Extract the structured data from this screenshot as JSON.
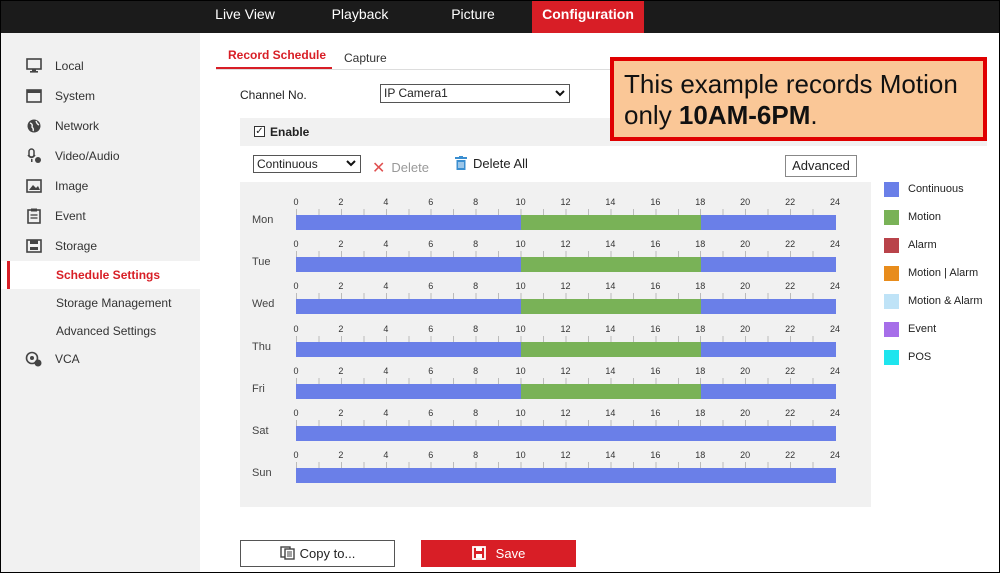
{
  "topnav": {
    "tabs": [
      {
        "label": "Live View"
      },
      {
        "label": "Playback"
      },
      {
        "label": "Picture"
      },
      {
        "label": "Configuration"
      }
    ]
  },
  "sidebar": {
    "items": [
      {
        "label": "Local",
        "icon": "monitor-icon"
      },
      {
        "label": "System",
        "icon": "window-icon"
      },
      {
        "label": "Network",
        "icon": "globe-icon"
      },
      {
        "label": "Video/Audio",
        "icon": "mic-icon"
      },
      {
        "label": "Image",
        "icon": "image-icon"
      },
      {
        "label": "Event",
        "icon": "clipboard-icon"
      },
      {
        "label": "Storage",
        "icon": "disk-icon"
      }
    ],
    "subitems": [
      {
        "label": "Schedule Settings"
      },
      {
        "label": "Storage Management"
      },
      {
        "label": "Advanced Settings"
      }
    ],
    "vca": {
      "label": "VCA",
      "icon": "vca-icon"
    }
  },
  "tabs": {
    "record_schedule": "Record Schedule",
    "capture": "Capture"
  },
  "channel": {
    "label": "Channel No.",
    "value": "IP Camera1"
  },
  "enable": {
    "label": "Enable",
    "checked": true
  },
  "toolbar": {
    "type_value": "Continuous",
    "delete_label": "Delete",
    "delete_all_label": "Delete All",
    "advanced_label": "Advanced"
  },
  "schedule": {
    "ticks": [
      "0",
      "2",
      "4",
      "6",
      "8",
      "10",
      "12",
      "14",
      "16",
      "18",
      "20",
      "22",
      "24"
    ],
    "days": [
      {
        "label": "Mon",
        "motion": [
          10,
          18
        ]
      },
      {
        "label": "Tue",
        "motion": [
          10,
          18
        ]
      },
      {
        "label": "Wed",
        "motion": [
          10,
          18
        ]
      },
      {
        "label": "Thu",
        "motion": [
          10,
          18
        ]
      },
      {
        "label": "Fri",
        "motion": [
          10,
          18
        ]
      },
      {
        "label": "Sat",
        "motion": null
      },
      {
        "label": "Sun",
        "motion": null
      }
    ]
  },
  "legend": [
    {
      "label": "Continuous",
      "color": "#6a7fe8"
    },
    {
      "label": "Motion",
      "color": "#79b257"
    },
    {
      "label": "Alarm",
      "color": "#b9434a"
    },
    {
      "label": "Motion | Alarm",
      "color": "#e88c1c"
    },
    {
      "label": "Motion & Alarm",
      "color": "#bfe3f7"
    },
    {
      "label": "Event",
      "color": "#a66ee9"
    },
    {
      "label": "POS",
      "color": "#1ee5ee"
    }
  ],
  "buttons": {
    "copy_label": "Copy to...",
    "save_label": "Save"
  },
  "callout": {
    "line1": "This example records Motion",
    "line2_prefix": "only ",
    "line2_bold": "10AM-6PM",
    "line2_suffix": "."
  },
  "colors": {
    "accent": "#d81e26",
    "continuous": "#6a7fe8",
    "motion": "#79b257"
  }
}
